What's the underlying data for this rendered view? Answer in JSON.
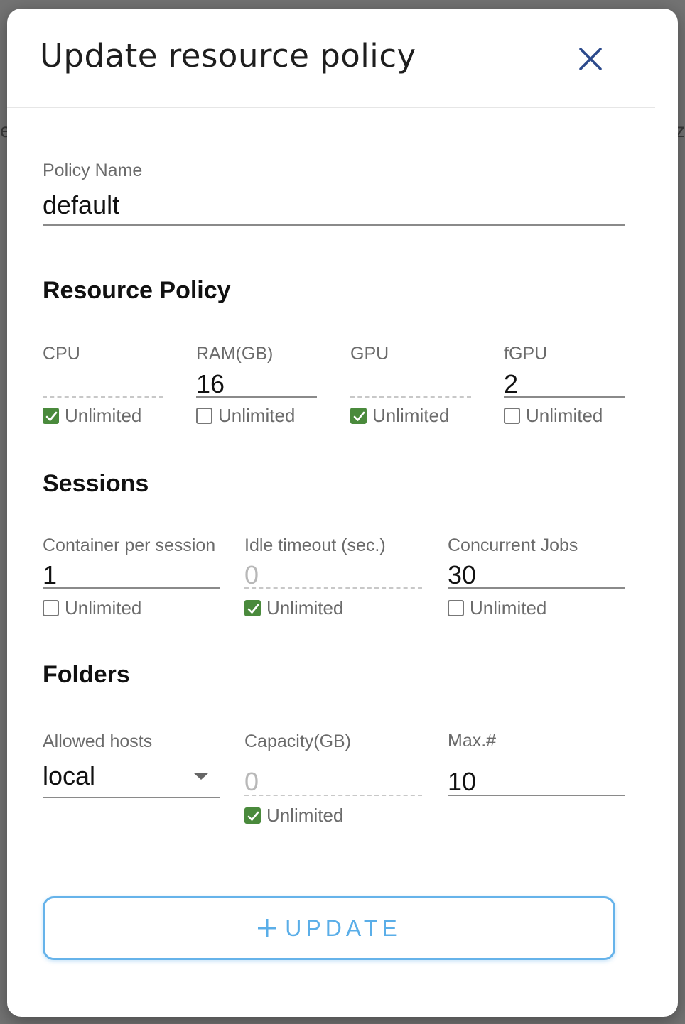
{
  "dialog": {
    "title": "Update resource policy"
  },
  "policy_name": {
    "label": "Policy Name",
    "value": "default"
  },
  "resource_policy": {
    "title": "Resource Policy",
    "fields": [
      {
        "label": "CPU",
        "value": "",
        "unlimited_label": "Unlimited",
        "unlimited": true
      },
      {
        "label": "RAM(GB)",
        "value": "16",
        "unlimited_label": "Unlimited",
        "unlimited": false
      },
      {
        "label": "GPU",
        "value": "",
        "unlimited_label": "Unlimited",
        "unlimited": true
      },
      {
        "label": "fGPU",
        "value": "2",
        "unlimited_label": "Unlimited",
        "unlimited": false
      }
    ]
  },
  "sessions": {
    "title": "Sessions",
    "fields": [
      {
        "label": "Container per session",
        "value": "1",
        "unlimited_label": "Unlimited",
        "unlimited": false
      },
      {
        "label": "Idle timeout (sec.)",
        "value": "0",
        "unlimited_label": "Unlimited",
        "unlimited": true
      },
      {
        "label": "Concurrent Jobs",
        "value": "30",
        "unlimited_label": "Unlimited",
        "unlimited": false
      }
    ]
  },
  "folders": {
    "title": "Folders",
    "allowed_hosts": {
      "label": "Allowed hosts",
      "value": "local"
    },
    "capacity": {
      "label": "Capacity(GB)",
      "value": "0",
      "unlimited_label": "Unlimited",
      "unlimited": true
    },
    "max": {
      "label": "Max.#",
      "value": "10"
    }
  },
  "update_button": {
    "label": "UPDATE"
  },
  "colors": {
    "accent": "#5aaee8",
    "checkbox_checked": "#4a8a3c"
  }
}
